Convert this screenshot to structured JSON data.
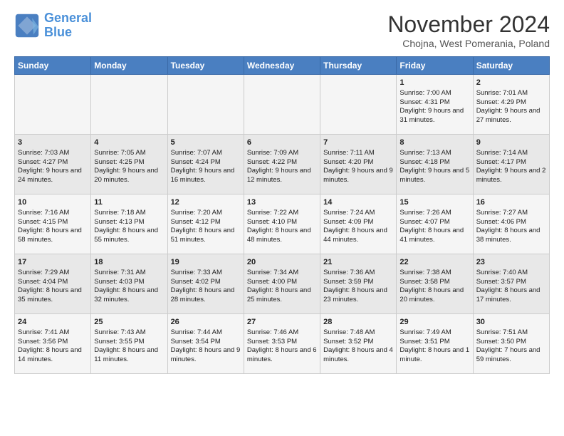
{
  "logo": {
    "line1": "General",
    "line2": "Blue"
  },
  "title": "November 2024",
  "subtitle": "Chojna, West Pomerania, Poland",
  "days_header": [
    "Sunday",
    "Monday",
    "Tuesday",
    "Wednesday",
    "Thursday",
    "Friday",
    "Saturday"
  ],
  "weeks": [
    [
      {
        "day": "",
        "content": ""
      },
      {
        "day": "",
        "content": ""
      },
      {
        "day": "",
        "content": ""
      },
      {
        "day": "",
        "content": ""
      },
      {
        "day": "",
        "content": ""
      },
      {
        "day": "1",
        "content": "Sunrise: 7:00 AM\nSunset: 4:31 PM\nDaylight: 9 hours and 31 minutes."
      },
      {
        "day": "2",
        "content": "Sunrise: 7:01 AM\nSunset: 4:29 PM\nDaylight: 9 hours and 27 minutes."
      }
    ],
    [
      {
        "day": "3",
        "content": "Sunrise: 7:03 AM\nSunset: 4:27 PM\nDaylight: 9 hours and 24 minutes."
      },
      {
        "day": "4",
        "content": "Sunrise: 7:05 AM\nSunset: 4:25 PM\nDaylight: 9 hours and 20 minutes."
      },
      {
        "day": "5",
        "content": "Sunrise: 7:07 AM\nSunset: 4:24 PM\nDaylight: 9 hours and 16 minutes."
      },
      {
        "day": "6",
        "content": "Sunrise: 7:09 AM\nSunset: 4:22 PM\nDaylight: 9 hours and 12 minutes."
      },
      {
        "day": "7",
        "content": "Sunrise: 7:11 AM\nSunset: 4:20 PM\nDaylight: 9 hours and 9 minutes."
      },
      {
        "day": "8",
        "content": "Sunrise: 7:13 AM\nSunset: 4:18 PM\nDaylight: 9 hours and 5 minutes."
      },
      {
        "day": "9",
        "content": "Sunrise: 7:14 AM\nSunset: 4:17 PM\nDaylight: 9 hours and 2 minutes."
      }
    ],
    [
      {
        "day": "10",
        "content": "Sunrise: 7:16 AM\nSunset: 4:15 PM\nDaylight: 8 hours and 58 minutes."
      },
      {
        "day": "11",
        "content": "Sunrise: 7:18 AM\nSunset: 4:13 PM\nDaylight: 8 hours and 55 minutes."
      },
      {
        "day": "12",
        "content": "Sunrise: 7:20 AM\nSunset: 4:12 PM\nDaylight: 8 hours and 51 minutes."
      },
      {
        "day": "13",
        "content": "Sunrise: 7:22 AM\nSunset: 4:10 PM\nDaylight: 8 hours and 48 minutes."
      },
      {
        "day": "14",
        "content": "Sunrise: 7:24 AM\nSunset: 4:09 PM\nDaylight: 8 hours and 44 minutes."
      },
      {
        "day": "15",
        "content": "Sunrise: 7:26 AM\nSunset: 4:07 PM\nDaylight: 8 hours and 41 minutes."
      },
      {
        "day": "16",
        "content": "Sunrise: 7:27 AM\nSunset: 4:06 PM\nDaylight: 8 hours and 38 minutes."
      }
    ],
    [
      {
        "day": "17",
        "content": "Sunrise: 7:29 AM\nSunset: 4:04 PM\nDaylight: 8 hours and 35 minutes."
      },
      {
        "day": "18",
        "content": "Sunrise: 7:31 AM\nSunset: 4:03 PM\nDaylight: 8 hours and 32 minutes."
      },
      {
        "day": "19",
        "content": "Sunrise: 7:33 AM\nSunset: 4:02 PM\nDaylight: 8 hours and 28 minutes."
      },
      {
        "day": "20",
        "content": "Sunrise: 7:34 AM\nSunset: 4:00 PM\nDaylight: 8 hours and 25 minutes."
      },
      {
        "day": "21",
        "content": "Sunrise: 7:36 AM\nSunset: 3:59 PM\nDaylight: 8 hours and 23 minutes."
      },
      {
        "day": "22",
        "content": "Sunrise: 7:38 AM\nSunset: 3:58 PM\nDaylight: 8 hours and 20 minutes."
      },
      {
        "day": "23",
        "content": "Sunrise: 7:40 AM\nSunset: 3:57 PM\nDaylight: 8 hours and 17 minutes."
      }
    ],
    [
      {
        "day": "24",
        "content": "Sunrise: 7:41 AM\nSunset: 3:56 PM\nDaylight: 8 hours and 14 minutes."
      },
      {
        "day": "25",
        "content": "Sunrise: 7:43 AM\nSunset: 3:55 PM\nDaylight: 8 hours and 11 minutes."
      },
      {
        "day": "26",
        "content": "Sunrise: 7:44 AM\nSunset: 3:54 PM\nDaylight: 8 hours and 9 minutes."
      },
      {
        "day": "27",
        "content": "Sunrise: 7:46 AM\nSunset: 3:53 PM\nDaylight: 8 hours and 6 minutes."
      },
      {
        "day": "28",
        "content": "Sunrise: 7:48 AM\nSunset: 3:52 PM\nDaylight: 8 hours and 4 minutes."
      },
      {
        "day": "29",
        "content": "Sunrise: 7:49 AM\nSunset: 3:51 PM\nDaylight: 8 hours and 1 minute."
      },
      {
        "day": "30",
        "content": "Sunrise: 7:51 AM\nSunset: 3:50 PM\nDaylight: 7 hours and 59 minutes."
      }
    ]
  ]
}
